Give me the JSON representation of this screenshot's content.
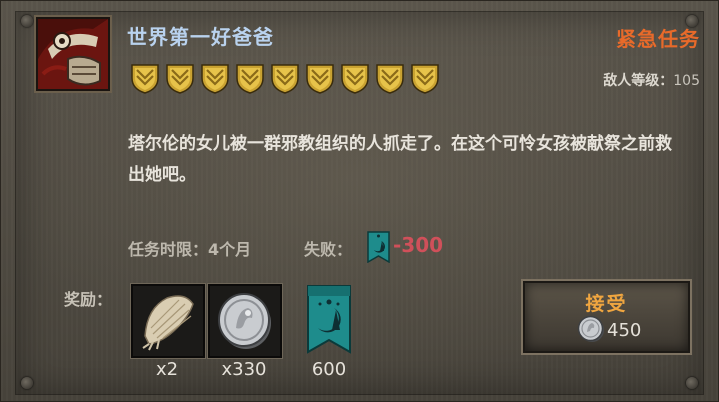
{
  "quest": {
    "title": "世界第一好爸爸",
    "urgency": "紧急任务",
    "enemy_level_label": "敌人等级：",
    "enemy_level": "105",
    "difficulty_skulls": 9,
    "description": "塔尔伦的女儿被一群邪教组织的人抓走了。在这个可怜女孩被献祭之前救出她吧。",
    "time_limit": "任务时限：4个月",
    "failure_label": "失败：",
    "failure_penalty": "-300"
  },
  "rewards": {
    "label": "奖励：",
    "items": [
      {
        "icon": "bone-fragment-icon",
        "quantity": "x2"
      },
      {
        "icon": "silver-coin-icon",
        "quantity": "x330"
      },
      {
        "icon": "moon-banner-icon",
        "quantity": "600"
      }
    ]
  },
  "accept_button": {
    "label": "接受",
    "cost_icon": "silver-coin-icon",
    "cost": "450"
  },
  "colors": {
    "title": "#b9d2ee",
    "urgent": "#e86a2a",
    "penalty": "#d0505a",
    "accept": "#f0a640",
    "banner_teal": "#1e8c8c"
  }
}
